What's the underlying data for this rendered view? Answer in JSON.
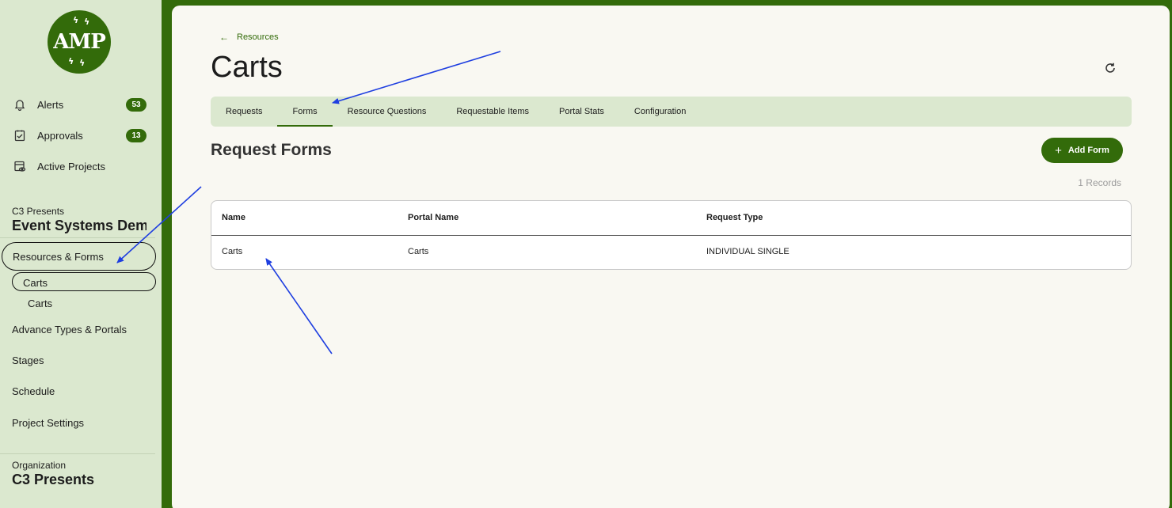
{
  "app": {
    "logo_text": "AMP"
  },
  "sidebar": {
    "nav": [
      {
        "label": "Alerts",
        "icon": "bell-icon",
        "badge": "53"
      },
      {
        "label": "Approvals",
        "icon": "clipboard-check-icon",
        "badge": "13"
      },
      {
        "label": "Active Projects",
        "icon": "calendar-eye-icon"
      }
    ],
    "project": {
      "company": "C3 Presents",
      "name": "Event Systems Demo"
    },
    "items": [
      {
        "label": "Resources & Forms"
      },
      {
        "label": "Carts"
      },
      {
        "label": "Carts"
      },
      {
        "label": "Advance Types & Portals"
      },
      {
        "label": "Stages"
      },
      {
        "label": "Schedule"
      },
      {
        "label": "Project Settings"
      }
    ],
    "organization": {
      "label": "Organization",
      "name": "C3 Presents"
    }
  },
  "main": {
    "breadcrumb": "Resources",
    "title": "Carts",
    "tabs": [
      {
        "label": "Requests"
      },
      {
        "label": "Forms",
        "active": true
      },
      {
        "label": "Resource Questions"
      },
      {
        "label": "Requestable Items"
      },
      {
        "label": "Portal Stats"
      },
      {
        "label": "Configuration"
      }
    ],
    "section_heading": "Request Forms",
    "add_button": "Add Form",
    "records_count": "1 Records",
    "table": {
      "columns": [
        "Name",
        "Portal Name",
        "Request Type"
      ],
      "rows": [
        [
          "Carts",
          "Carts",
          "INDIVIDUAL SINGLE"
        ]
      ]
    }
  },
  "colors": {
    "brand_green": "#336b0a",
    "sidebar_bg": "#dbe8cf",
    "main_bg": "#f9f8f2",
    "annotation_arrow": "#1f3fe0"
  }
}
